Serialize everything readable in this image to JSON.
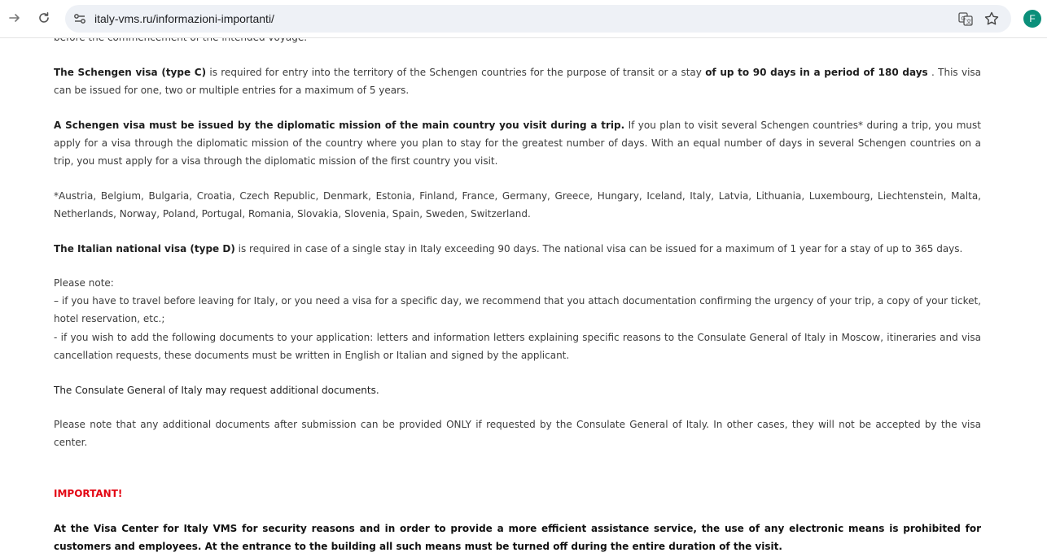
{
  "browser": {
    "url": "italy-vms.ru/informazioni-importanti/",
    "avatar_letter": "F"
  },
  "content": {
    "cut_line": "before the commencement of the intended voyage.",
    "p1_b1": "The Schengen visa (type C)",
    "p1_t1": " is required for entry into the territory of the Schengen countries for the purpose of transit or a stay ",
    "p1_b2": "of up to 90 days in a period of 180 days",
    "p1_t2": " . This visa can be issued for one, two or multiple entries for a maximum of 5 years.",
    "p2_b1": "A Schengen visa must be issued by the diplomatic mission of the main country you visit during a trip.",
    "p2_t1": " If you plan to visit several Schengen countries* during a trip, you must apply for a visa through the diplomatic mission of the country where you plan to stay for the greatest number of days. With an equal number of days in several Schengen countries on a trip, you must apply for a visa through the diplomatic mission of the first country you visit.",
    "p3": "*Austria, Belgium, Bulgaria, Croatia, Czech Republic, Denmark, Estonia, Finland, France, Germany, Greece, Hungary, Iceland, Italy, Latvia, Lithuania, Luxembourg, Liechtenstein, Malta, Netherlands, Norway, Poland, Portugal, Romania, Slovakia, Slovenia, Spain, Sweden, Switzerland.",
    "p4_b1": "The Italian national visa (type D)",
    "p4_t1": " is required in case of a single stay in Italy exceeding 90 days. The national visa can be issued for a maximum of 1 year for a stay of up to 365 days.",
    "note_title": "Please note:",
    "note_1": "– if you have to travel before leaving for Italy, or you need a visa for a specific day, we recommend that you attach documentation confirming the urgency of your trip, a copy of your ticket, hotel reservation, etc.;",
    "note_2": "- if you wish to add the following documents to your application: letters and information letters explaining specific reasons to the Consulate General of Italy in Moscow, itineraries and visa cancellation requests, these documents must be written in English or Italian and signed by the applicant.",
    "p6": "The Consulate General of Italy may request additional documents.",
    "p7": "Please note that any additional documents after submission can be provided ONLY if requested by the Consulate General of Italy. In other cases, they will not be accepted by the visa center.",
    "important": "IMPORTANT!",
    "p8": "At the Visa Center for Italy VMS for security reasons and in order to provide a more efficient assistance service, the use of any electronic means is prohibited for customers and employees. At the entrance to the building all such means must be turned off during the entire duration of the visit."
  }
}
